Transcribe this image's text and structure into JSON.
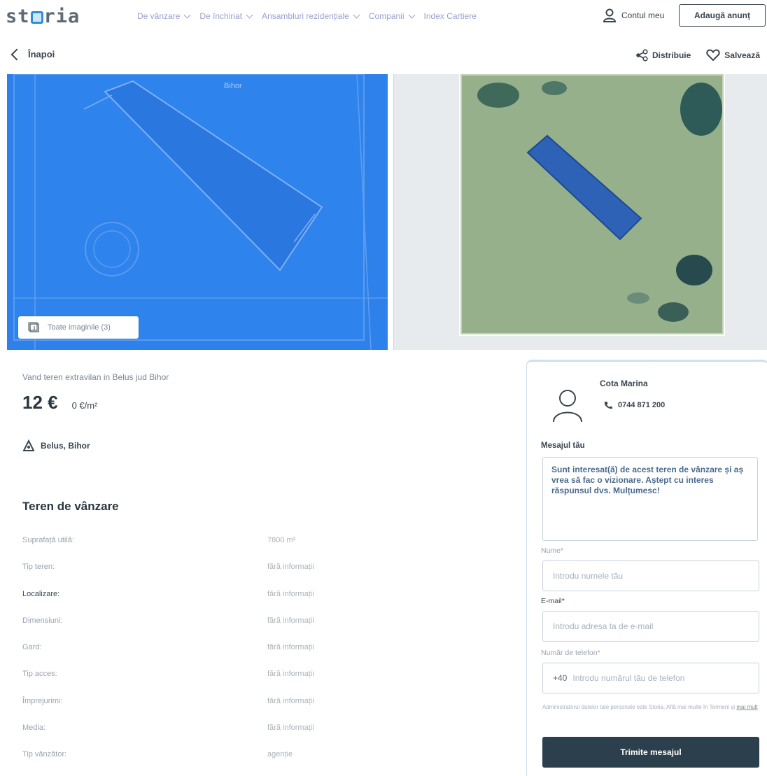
{
  "header": {
    "logo": "storia",
    "nav": [
      {
        "label": "De vânzare",
        "has_dropdown": true
      },
      {
        "label": "De închiriat",
        "has_dropdown": true
      },
      {
        "label": "Ansambluri rezidențiale",
        "has_dropdown": true
      },
      {
        "label": "Companii",
        "has_dropdown": true
      },
      {
        "label": "Index Cartiere",
        "has_dropdown": false
      }
    ],
    "account_label": "Contul meu",
    "add_ad_label": "Adaugă anunț"
  },
  "toolbar": {
    "back_label": "Înapoi",
    "share_label": "Distribuie",
    "save_label": "Salvează"
  },
  "gallery": {
    "all_images_label": "Toate imaginile (3)"
  },
  "listing": {
    "title": "Vand teren extravilan in Belus jud Bihor",
    "price": "12 €",
    "price_per_m2": "0 €/m²",
    "location": "Belus, Bihor",
    "section_title": "Teren de vânzare",
    "specs": [
      {
        "label": "Suprafață utilă:",
        "value": "7800 m²"
      },
      {
        "label": "Tip teren:",
        "value": "fără informații"
      },
      {
        "label": "Localizare:",
        "value": "fără informații"
      },
      {
        "label": "Dimensiuni:",
        "value": "fără informații"
      },
      {
        "label": "Gard:",
        "value": "fără informații"
      },
      {
        "label": "Tip acces:",
        "value": "fără informații"
      },
      {
        "label": "Împrejurimi:",
        "value": "fără informații"
      },
      {
        "label": "Media:",
        "value": "fără informații"
      },
      {
        "label": "Tip vânzător:",
        "value": "agenție"
      }
    ]
  },
  "contact": {
    "seller_name": "Cota Marina",
    "phone": "0744 871 200",
    "message_label": "Mesajul tău",
    "message_text": "Sunt interesat(ă) de acest teren de vânzare și aș vrea să fac o vizionare. Aștept cu interes răspunsul dvs. Mulțumesc!",
    "name_label": "Nume*",
    "name_placeholder": "Introdu numele tău",
    "email_label": "E-mail*",
    "email_placeholder": "Introdu adresa ta de e-mail",
    "phone_label": "Număr de telefon*",
    "phone_prefix": "+40",
    "phone_placeholder": "Introdu numărul tău de telefon",
    "terms_text": "Administratorul datelor tale personale este Storia. Află mai multe în Termeni și ",
    "terms_link": "mai mult",
    "send_label": "Trimite mesajul"
  },
  "colors": {
    "accent_blue": "#2f7fe8",
    "button_dark": "#2c3f4c",
    "nav_text": "#9a9fd0"
  }
}
